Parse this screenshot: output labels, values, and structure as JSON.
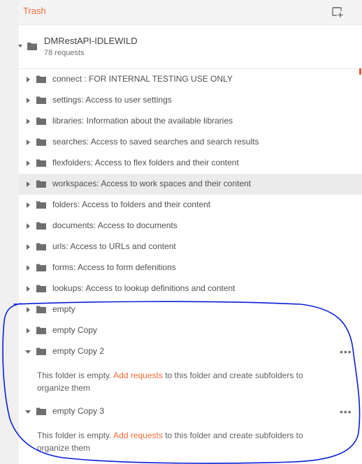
{
  "header": {
    "trash_label": "Trash"
  },
  "collection": {
    "name": "DMRestAPI-IDLEWILD",
    "count": "78 requests"
  },
  "folders": [
    {
      "label": "connect : FOR INTERNAL TESTING USE ONLY"
    },
    {
      "label": "settings: Access to user settings"
    },
    {
      "label": "libraries: Information about the available libraries"
    },
    {
      "label": "searches: Access to saved searches and search results"
    },
    {
      "label": "flexfolders: Access to flex folders and their content"
    },
    {
      "label": "workspaces: Access to work spaces and their content"
    },
    {
      "label": "folders: Access to folders and their content"
    },
    {
      "label": "documents: Access to documents"
    },
    {
      "label": "urls: Access to URLs and content"
    },
    {
      "label": "forms: Access to form defenitions"
    },
    {
      "label": "lookups: Access to lookup definitions and content"
    },
    {
      "label": "empty"
    },
    {
      "label": "empty Copy"
    },
    {
      "label": "empty Copy 2"
    },
    {
      "label": "empty Copy 3"
    }
  ],
  "empty_state": {
    "prefix": "This folder is empty. ",
    "link": "Add requests",
    "suffix": " to this folder and create subfolders to organize them"
  },
  "more_glyph": "•••",
  "colors": {
    "accent": "#f26b3a",
    "annotation": "#0a1fd6",
    "hover_row": "#ebebeb"
  }
}
